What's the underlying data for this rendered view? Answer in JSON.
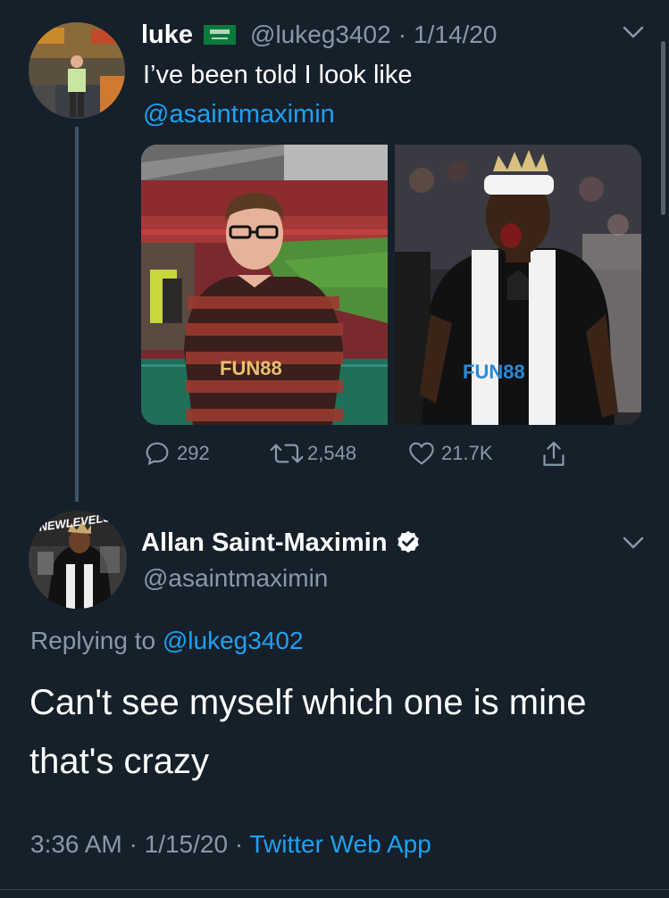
{
  "tweet": {
    "display_name": "luke",
    "flag_icon": "saudi-flag-icon",
    "handle": "@lukeg3402",
    "separator": "·",
    "date": "1/14/20",
    "text_line1": "I’ve been told I look like",
    "mention": "@asaintmaximin",
    "photo_left_shirt_text": "FUN88",
    "photo_right_shirt_text": "FUN88",
    "actions": {
      "replies": "292",
      "retweets": "2,548",
      "likes": "21.7K"
    }
  },
  "reply": {
    "avatar_banner": "#NEWLEVELS",
    "display_name": "Allan Saint-Maximin",
    "verified": true,
    "handle": "@asaintmaximin",
    "replying_prefix": "Replying to",
    "replying_to": "@lukeg3402",
    "text_line1": "Can't see myself which one is mine",
    "text_line2": "that's crazy",
    "time": "3:36 AM",
    "sep1": "·",
    "date": "1/15/20",
    "sep2": "·",
    "source": "Twitter Web App"
  },
  "colors": {
    "background": "#15202b",
    "text": "#ffffff",
    "muted": "#8899a6",
    "link": "#1da1f2"
  }
}
